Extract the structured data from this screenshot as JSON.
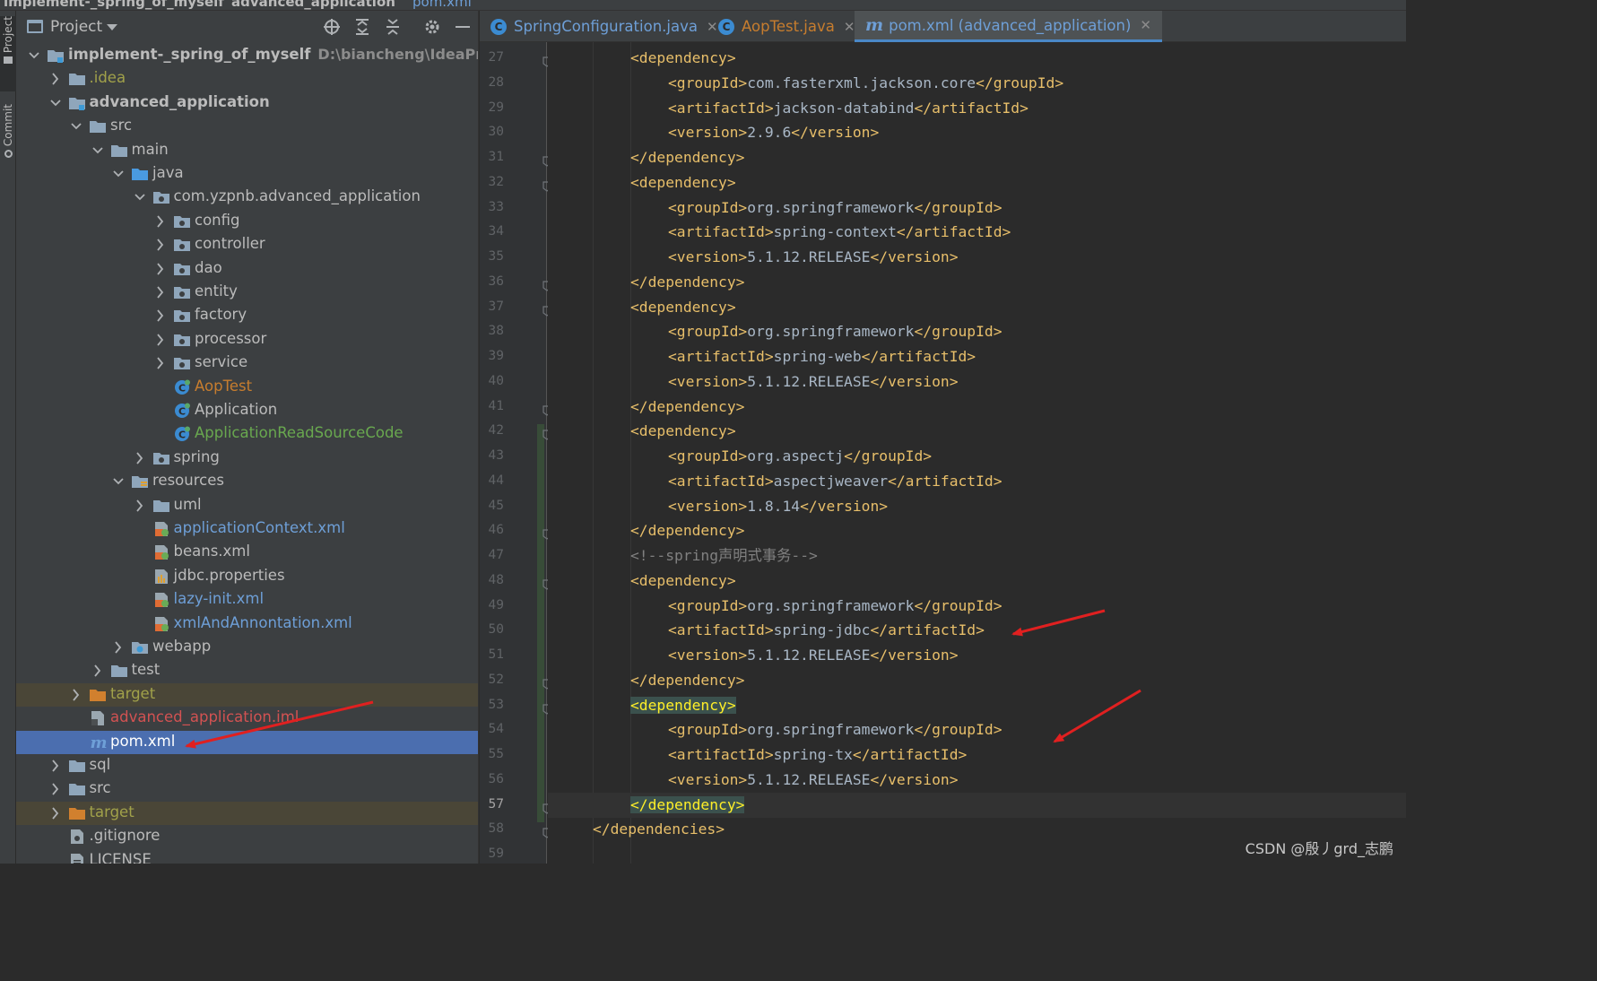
{
  "breadcrumb": {
    "project": "implement-_spring_of_myself",
    "module": "advanced_application",
    "file": "pom.xml"
  },
  "toolstrip": {
    "project_tab": "Project",
    "commit_tab": "Commit"
  },
  "project_panel": {
    "title": "Project",
    "root": {
      "name": "implement-_spring_of_myself",
      "path": "D:\\biancheng\\IdeaProjects\\im"
    },
    "tree": [
      {
        "label": "implement-_spring_of_myself",
        "depth": 0,
        "expanded": true,
        "icon": "module-folder-icon",
        "color": "bold"
      },
      {
        "label": ".idea",
        "depth": 1,
        "expanded": false,
        "icon": "folder-icon",
        "color": "olive"
      },
      {
        "label": "advanced_application",
        "depth": 1,
        "expanded": true,
        "icon": "module-folder-icon",
        "color": "bold"
      },
      {
        "label": "src",
        "depth": 2,
        "expanded": true,
        "icon": "folder-icon",
        "color": "def"
      },
      {
        "label": "main",
        "depth": 3,
        "expanded": true,
        "icon": "folder-icon",
        "color": "def"
      },
      {
        "label": "java",
        "depth": 4,
        "expanded": true,
        "icon": "source-folder-icon",
        "color": "def"
      },
      {
        "label": "com.yzpnb.advanced_application",
        "depth": 5,
        "expanded": true,
        "icon": "package-icon",
        "color": "def"
      },
      {
        "label": "config",
        "depth": 6,
        "expanded": false,
        "icon": "package-icon",
        "color": "def"
      },
      {
        "label": "controller",
        "depth": 6,
        "expanded": false,
        "icon": "package-icon",
        "color": "def"
      },
      {
        "label": "dao",
        "depth": 6,
        "expanded": false,
        "icon": "package-icon",
        "color": "def"
      },
      {
        "label": "entity",
        "depth": 6,
        "expanded": false,
        "icon": "package-icon",
        "color": "def"
      },
      {
        "label": "factory",
        "depth": 6,
        "expanded": false,
        "icon": "package-icon",
        "color": "def"
      },
      {
        "label": "processor",
        "depth": 6,
        "expanded": false,
        "icon": "package-icon",
        "color": "def"
      },
      {
        "label": "service",
        "depth": 6,
        "expanded": false,
        "icon": "package-icon",
        "color": "def"
      },
      {
        "label": "AopTest",
        "depth": 6,
        "expanded": null,
        "icon": "java-class-icon",
        "color": "orange"
      },
      {
        "label": "Application",
        "depth": 6,
        "expanded": null,
        "icon": "java-class-icon",
        "color": "def"
      },
      {
        "label": "ApplicationReadSourceCode",
        "depth": 6,
        "expanded": null,
        "icon": "java-class-icon",
        "color": "green"
      },
      {
        "label": "spring",
        "depth": 5,
        "expanded": false,
        "icon": "package-icon",
        "color": "def"
      },
      {
        "label": "resources",
        "depth": 4,
        "expanded": true,
        "icon": "resources-folder-icon",
        "color": "def"
      },
      {
        "label": "uml",
        "depth": 5,
        "expanded": false,
        "icon": "folder-icon",
        "color": "def"
      },
      {
        "label": "applicationContext.xml",
        "depth": 5,
        "expanded": null,
        "icon": "spring-xml-icon",
        "color": "blue"
      },
      {
        "label": "beans.xml",
        "depth": 5,
        "expanded": null,
        "icon": "spring-xml-icon",
        "color": "def"
      },
      {
        "label": "jdbc.properties",
        "depth": 5,
        "expanded": null,
        "icon": "properties-file-icon",
        "color": "def"
      },
      {
        "label": "lazy-init.xml",
        "depth": 5,
        "expanded": null,
        "icon": "spring-xml-icon",
        "color": "blue"
      },
      {
        "label": "xmlAndAnnontation.xml",
        "depth": 5,
        "expanded": null,
        "icon": "spring-xml-icon",
        "color": "blue"
      },
      {
        "label": "webapp",
        "depth": 4,
        "expanded": false,
        "icon": "web-folder-icon",
        "color": "def"
      },
      {
        "label": "test",
        "depth": 3,
        "expanded": false,
        "icon": "folder-icon",
        "color": "def"
      },
      {
        "label": "target",
        "depth": 2,
        "expanded": false,
        "icon": "excluded-folder-icon",
        "color": "olive",
        "excluded": true
      },
      {
        "label": "advanced_application.iml",
        "depth": 2,
        "expanded": null,
        "icon": "iml-file-icon",
        "color": "red"
      },
      {
        "label": "pom.xml",
        "depth": 2,
        "expanded": null,
        "icon": "maven-icon",
        "color": "white",
        "selected": true
      },
      {
        "label": "sql",
        "depth": 1,
        "expanded": false,
        "icon": "folder-icon",
        "color": "def"
      },
      {
        "label": "src",
        "depth": 1,
        "expanded": false,
        "icon": "folder-icon",
        "color": "def"
      },
      {
        "label": "target",
        "depth": 1,
        "expanded": false,
        "icon": "excluded-folder-icon",
        "color": "olive",
        "excluded": true
      },
      {
        "label": ".gitignore",
        "depth": 1,
        "expanded": null,
        "icon": "gitignore-file-icon",
        "color": "def"
      },
      {
        "label": "LICENSE",
        "depth": 1,
        "expanded": null,
        "icon": "text-file-icon",
        "color": "def"
      }
    ]
  },
  "editor": {
    "tabs": [
      {
        "label": "SpringConfiguration.java",
        "icon": "java-class-icon",
        "active": false
      },
      {
        "label": "AopTest.java",
        "icon": "java-class-icon",
        "active": false
      },
      {
        "label": "pom.xml (advanced_application)",
        "icon": "maven-icon",
        "active": true
      }
    ],
    "current_line": 57,
    "lines": [
      {
        "n": 27,
        "indent": 2,
        "parts": [
          [
            "tag",
            "<dependency>"
          ]
        ]
      },
      {
        "n": 28,
        "indent": 3,
        "parts": [
          [
            "tag",
            "<groupId>"
          ],
          [
            "txt",
            "com.fasterxml.jackson.core"
          ],
          [
            "tag",
            "</groupId>"
          ]
        ]
      },
      {
        "n": 29,
        "indent": 3,
        "parts": [
          [
            "tag",
            "<artifactId>"
          ],
          [
            "txt",
            "jackson-databind"
          ],
          [
            "tag",
            "</artifactId>"
          ]
        ]
      },
      {
        "n": 30,
        "indent": 3,
        "parts": [
          [
            "tag",
            "<version>"
          ],
          [
            "txt",
            "2.9.6"
          ],
          [
            "tag",
            "</version>"
          ]
        ]
      },
      {
        "n": 31,
        "indent": 2,
        "parts": [
          [
            "tag",
            "</dependency>"
          ]
        ]
      },
      {
        "n": 32,
        "indent": 2,
        "parts": [
          [
            "tag",
            "<dependency>"
          ]
        ]
      },
      {
        "n": 33,
        "indent": 3,
        "parts": [
          [
            "tag",
            "<groupId>"
          ],
          [
            "txt",
            "org.springframework"
          ],
          [
            "tag",
            "</groupId>"
          ]
        ]
      },
      {
        "n": 34,
        "indent": 3,
        "parts": [
          [
            "tag",
            "<artifactId>"
          ],
          [
            "txt",
            "spring-context"
          ],
          [
            "tag",
            "</artifactId>"
          ]
        ]
      },
      {
        "n": 35,
        "indent": 3,
        "parts": [
          [
            "tag",
            "<version>"
          ],
          [
            "txt",
            "5.1.12.RELEASE"
          ],
          [
            "tag",
            "</version>"
          ]
        ]
      },
      {
        "n": 36,
        "indent": 2,
        "parts": [
          [
            "tag",
            "</dependency>"
          ]
        ]
      },
      {
        "n": 37,
        "indent": 2,
        "parts": [
          [
            "tag",
            "<dependency>"
          ]
        ]
      },
      {
        "n": 38,
        "indent": 3,
        "parts": [
          [
            "tag",
            "<groupId>"
          ],
          [
            "txt",
            "org.springframework"
          ],
          [
            "tag",
            "</groupId>"
          ]
        ]
      },
      {
        "n": 39,
        "indent": 3,
        "parts": [
          [
            "tag",
            "<artifactId>"
          ],
          [
            "txt",
            "spring-web"
          ],
          [
            "tag",
            "</artifactId>"
          ]
        ]
      },
      {
        "n": 40,
        "indent": 3,
        "parts": [
          [
            "tag",
            "<version>"
          ],
          [
            "txt",
            "5.1.12.RELEASE"
          ],
          [
            "tag",
            "</version>"
          ]
        ]
      },
      {
        "n": 41,
        "indent": 2,
        "parts": [
          [
            "tag",
            "</dependency>"
          ]
        ]
      },
      {
        "n": 42,
        "indent": 2,
        "parts": [
          [
            "tag",
            "<dependency>"
          ]
        ]
      },
      {
        "n": 43,
        "indent": 3,
        "parts": [
          [
            "tag",
            "<groupId>"
          ],
          [
            "txt",
            "org.aspectj"
          ],
          [
            "tag",
            "</groupId>"
          ]
        ]
      },
      {
        "n": 44,
        "indent": 3,
        "parts": [
          [
            "tag",
            "<artifactId>"
          ],
          [
            "txt",
            "aspectjweaver"
          ],
          [
            "tag",
            "</artifactId>"
          ]
        ]
      },
      {
        "n": 45,
        "indent": 3,
        "parts": [
          [
            "tag",
            "<version>"
          ],
          [
            "txt",
            "1.8.14"
          ],
          [
            "tag",
            "</version>"
          ]
        ]
      },
      {
        "n": 46,
        "indent": 2,
        "parts": [
          [
            "tag",
            "</dependency>"
          ]
        ]
      },
      {
        "n": 47,
        "indent": 2,
        "parts": [
          [
            "cmt",
            "<!--spring声明式事务-->"
          ]
        ]
      },
      {
        "n": 48,
        "indent": 2,
        "parts": [
          [
            "tag",
            "<dependency>"
          ]
        ]
      },
      {
        "n": 49,
        "indent": 3,
        "parts": [
          [
            "tag",
            "<groupId>"
          ],
          [
            "txt",
            "org.springframework"
          ],
          [
            "tag",
            "</groupId>"
          ]
        ]
      },
      {
        "n": 50,
        "indent": 3,
        "parts": [
          [
            "tag",
            "<artifactId>"
          ],
          [
            "txt",
            "spring-jdbc"
          ],
          [
            "tag",
            "</artifactId>"
          ]
        ]
      },
      {
        "n": 51,
        "indent": 3,
        "parts": [
          [
            "tag",
            "<version>"
          ],
          [
            "txt",
            "5.1.12.RELEASE"
          ],
          [
            "tag",
            "</version>"
          ]
        ]
      },
      {
        "n": 52,
        "indent": 2,
        "parts": [
          [
            "tag",
            "</dependency>"
          ]
        ]
      },
      {
        "n": 53,
        "indent": 2,
        "parts": [
          [
            "hlbright",
            "<dependency>"
          ]
        ]
      },
      {
        "n": 54,
        "indent": 3,
        "parts": [
          [
            "tag",
            "<groupId>"
          ],
          [
            "txt",
            "org.springframework"
          ],
          [
            "tag",
            "</groupId>"
          ]
        ]
      },
      {
        "n": 55,
        "indent": 3,
        "parts": [
          [
            "tag",
            "<artifactId>"
          ],
          [
            "txt",
            "spring-tx"
          ],
          [
            "tag",
            "</artifactId>"
          ]
        ]
      },
      {
        "n": 56,
        "indent": 3,
        "parts": [
          [
            "tag",
            "<version>"
          ],
          [
            "txt",
            "5.1.12.RELEASE"
          ],
          [
            "tag",
            "</version>"
          ]
        ]
      },
      {
        "n": 57,
        "indent": 2,
        "parts": [
          [
            "hlbright",
            "</dependency>"
          ]
        ]
      },
      {
        "n": 58,
        "indent": 1,
        "parts": [
          [
            "tag",
            "</dependencies>"
          ]
        ]
      },
      {
        "n": 59,
        "indent": 0,
        "parts": []
      }
    ]
  },
  "watermark": "CSDN @殷丿grd_志鹏",
  "colors": {
    "accent": "#4b6eaf",
    "annotation_arrow": "#e02020",
    "xml_tag": "#e8bf6a",
    "xml_text": "#a9b7c6"
  }
}
